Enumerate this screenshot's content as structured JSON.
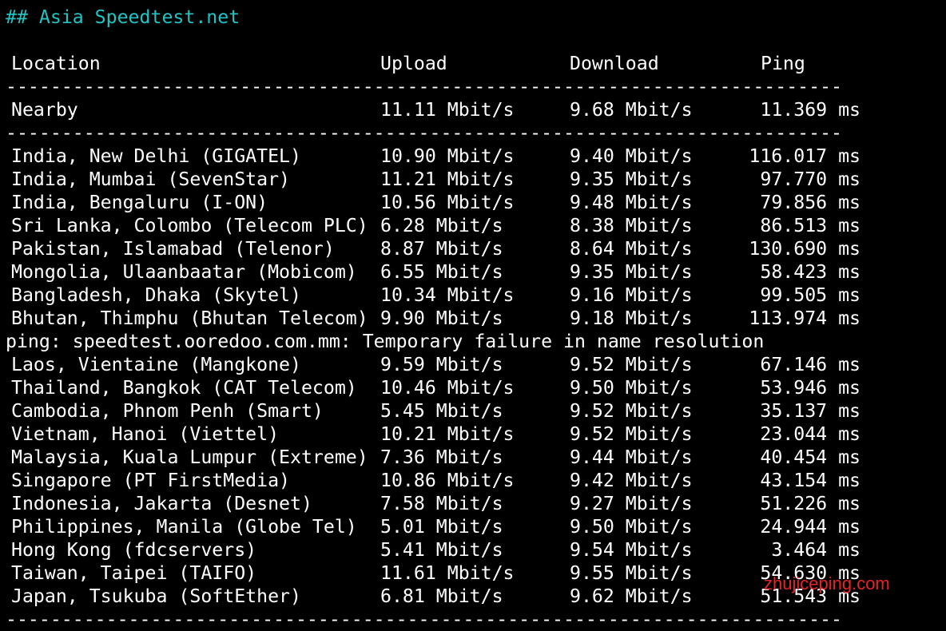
{
  "title": "## Asia Speedtest.net",
  "headers": {
    "location": "Location",
    "upload": "Upload",
    "download": "Download",
    "ping": "Ping"
  },
  "separator": "-----------------------------------------------------------------------------",
  "nearby": {
    "location": "Nearby",
    "upload": "11.11 Mbit/s",
    "download": "9.68 Mbit/s",
    "ping": "11.369 ms"
  },
  "rows": [
    {
      "location": "India, New Delhi (GIGATEL)",
      "upload": "10.90 Mbit/s",
      "download": "9.40 Mbit/s",
      "ping": "116.017 ms"
    },
    {
      "location": "India, Mumbai (SevenStar)",
      "upload": "11.21 Mbit/s",
      "download": "9.35 Mbit/s",
      "ping": "97.770 ms"
    },
    {
      "location": "India, Bengaluru (I-ON)",
      "upload": "10.56 Mbit/s",
      "download": "9.48 Mbit/s",
      "ping": "79.856 ms"
    },
    {
      "location": "Sri Lanka, Colombo (Telecom PLC)",
      "upload": "6.28 Mbit/s",
      "download": "8.38 Mbit/s",
      "ping": "86.513 ms"
    },
    {
      "location": "Pakistan, Islamabad (Telenor)",
      "upload": "8.87 Mbit/s",
      "download": "8.64 Mbit/s",
      "ping": "130.690 ms"
    },
    {
      "location": "Mongolia, Ulaanbaatar (Mobicom)",
      "upload": "6.55 Mbit/s",
      "download": "9.35 Mbit/s",
      "ping": "58.423 ms"
    },
    {
      "location": "Bangladesh, Dhaka (Skytel)",
      "upload": "10.34 Mbit/s",
      "download": "9.16 Mbit/s",
      "ping": "99.505 ms"
    },
    {
      "location": "Bhutan, Thimphu (Bhutan Telecom)",
      "upload": "9.90 Mbit/s",
      "download": "9.18 Mbit/s",
      "ping": "113.974 ms"
    }
  ],
  "error_line": "ping: speedtest.ooredoo.com.mm: Temporary failure in name resolution",
  "rows2": [
    {
      "location": "Laos, Vientaine (Mangkone)",
      "upload": "9.59 Mbit/s",
      "download": "9.52 Mbit/s",
      "ping": "67.146 ms"
    },
    {
      "location": "Thailand, Bangkok (CAT Telecom)",
      "upload": "10.46 Mbit/s",
      "download": "9.50 Mbit/s",
      "ping": "53.946 ms"
    },
    {
      "location": "Cambodia, Phnom Penh (Smart)",
      "upload": "5.45 Mbit/s",
      "download": "9.52 Mbit/s",
      "ping": "35.137 ms"
    },
    {
      "location": "Vietnam, Hanoi (Viettel)",
      "upload": "10.21 Mbit/s",
      "download": "9.52 Mbit/s",
      "ping": "23.044 ms"
    },
    {
      "location": "Malaysia, Kuala Lumpur (Extreme)",
      "upload": "7.36 Mbit/s",
      "download": "9.44 Mbit/s",
      "ping": "40.454 ms"
    },
    {
      "location": "Singapore (PT FirstMedia)",
      "upload": "10.86 Mbit/s",
      "download": "9.42 Mbit/s",
      "ping": "43.154 ms"
    },
    {
      "location": "Indonesia, Jakarta (Desnet)",
      "upload": "7.58 Mbit/s",
      "download": "9.27 Mbit/s",
      "ping": "51.226 ms"
    },
    {
      "location": "Philippines, Manila (Globe Tel)",
      "upload": "5.01 Mbit/s",
      "download": "9.50 Mbit/s",
      "ping": "24.944 ms"
    },
    {
      "location": "Hong Kong (fdcservers)",
      "upload": "5.41 Mbit/s",
      "download": "9.54 Mbit/s",
      "ping": "3.464 ms"
    },
    {
      "location": "Taiwan, Taipei (TAIFO)",
      "upload": "11.61 Mbit/s",
      "download": "9.55 Mbit/s",
      "ping": "54.630 ms"
    },
    {
      "location": "Japan, Tsukuba (SoftEther)",
      "upload": "6.81 Mbit/s",
      "download": "9.62 Mbit/s",
      "ping": "51.543 ms"
    }
  ],
  "watermark": "zhujiceping.com",
  "colors": {
    "background": "#000000",
    "text": "#ffffff",
    "title": "#23c3c3",
    "watermark": "#e8222a"
  }
}
